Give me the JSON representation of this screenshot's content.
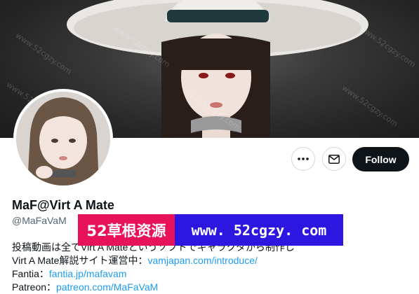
{
  "profile": {
    "display_name": "MaF@Virt A Mate",
    "handle": "@MaFaVaM",
    "bio_line1": "投稿動画は全てVirt A Mateというソフトでキャラクタから制作し",
    "bio_line2_text": "Virt A Mate解説サイト運営中：",
    "bio_line2_link": "vamjapan.com/introduce/",
    "bio_line3_text": "Fantia：",
    "bio_line3_link": "fantia.jp/mafavam",
    "bio_line4_text": "Patreon：",
    "bio_line4_link": "patreon.com/MaFaVaM"
  },
  "actions": {
    "follow_label": "Follow",
    "more_icon": "more-horizontal-icon",
    "message_icon": "envelope-icon"
  },
  "promo": {
    "left_text": "52草根资源",
    "right_text": "www. 52cgzy. com"
  },
  "watermark": {
    "text": "www.52cgzy.com"
  },
  "colors": {
    "follow_bg": "#0f1419",
    "link": "#1d9bf0",
    "promo_left": "#e8125a",
    "promo_right": "#2d16e0"
  }
}
